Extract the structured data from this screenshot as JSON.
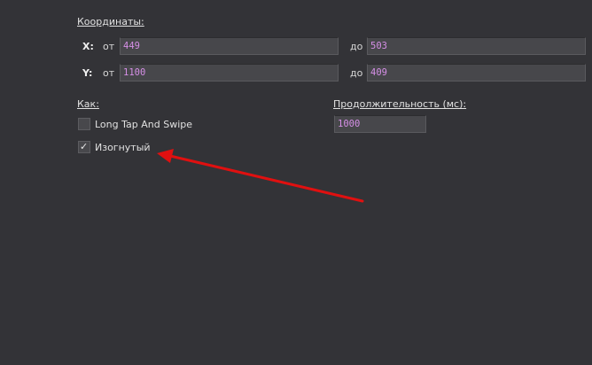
{
  "coordinates": {
    "title": "Координаты:",
    "x_row": {
      "axis": "X:",
      "from_label": "от",
      "from_value": "449",
      "to_label": "до",
      "to_value": "503"
    },
    "y_row": {
      "axis": "Y:",
      "from_label": "от",
      "from_value": "1100",
      "to_label": "до",
      "to_value": "409"
    }
  },
  "how": {
    "title": "Как:",
    "options": [
      {
        "label": "Long Tap And Swipe",
        "checked": false
      },
      {
        "label": "Изогнутый",
        "checked": true,
        "check_glyph": "✓"
      }
    ]
  },
  "duration": {
    "title": "Продолжительность (мс):",
    "value": "1000"
  },
  "colors": {
    "background": "#333337",
    "field_background": "#47474b",
    "field_text": "#d58fe6",
    "annotation_arrow": "#e01010"
  },
  "annotation": {
    "icon": "red-arrow-icon"
  }
}
